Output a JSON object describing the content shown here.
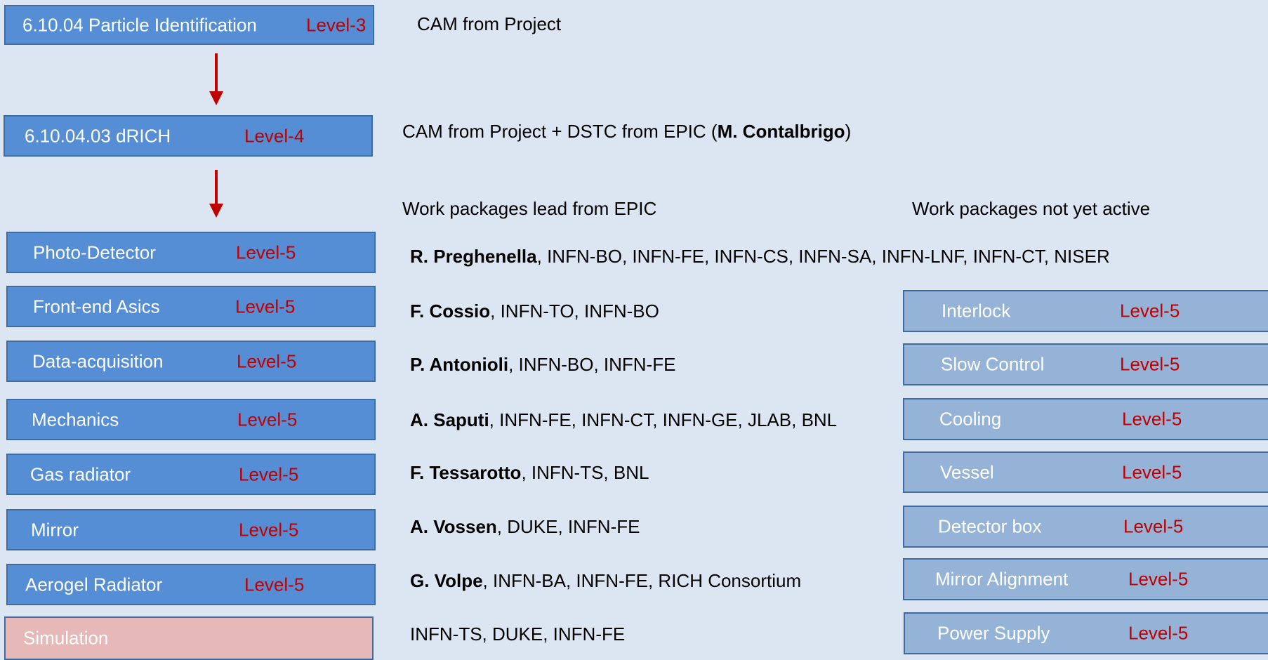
{
  "level3": {
    "label": "6.10.04 Particle Identification",
    "level": "Level-3"
  },
  "level4": {
    "label": "6.10.04.03  dRICH",
    "level": "Level-4"
  },
  "cam_project": "CAM from Project",
  "cam_dstc": {
    "prefix": "CAM from Project + DSTC from EPIC (",
    "name": "M. Contalbrigo",
    "suffix": ")"
  },
  "headers": {
    "active": "Work packages lead from EPIC",
    "inactive": "Work packages not yet active"
  },
  "work_packages": [
    {
      "label": "Photo-Detector",
      "level": "Level-5",
      "lead": "R. Preghenella",
      "members": ", INFN-BO, INFN-FE, INFN-CS, INFN-SA, INFN-LNF, INFN-CT, NISER"
    },
    {
      "label": "Front-end Asics",
      "level": "Level-5",
      "lead": "F. Cossio",
      "members": ",  INFN-TO, INFN-BO"
    },
    {
      "label": "Data-acquisition",
      "level": "Level-5",
      "lead": "P. Antonioli",
      "members": ", INFN-BO, INFN-FE"
    },
    {
      "label": "Mechanics",
      "level": "Level-5",
      "lead": "A. Saputi",
      "members": ", INFN-FE, INFN-CT, INFN-GE, JLAB, BNL"
    },
    {
      "label": "Gas radiator",
      "level": "Level-5",
      "lead": "F. Tessarotto",
      "members": ", INFN-TS, BNL"
    },
    {
      "label": "Mirror",
      "level": "Level-5",
      "lead": "A. Vossen",
      "members": ", DUKE, INFN-FE"
    },
    {
      "label": "Aerogel Radiator",
      "level": "Level-5",
      "lead": "G. Volpe",
      "members": ", INFN-BA, INFN-FE, RICH Consortium"
    },
    {
      "label": "Simulation",
      "level": "",
      "lead": "",
      "members": "INFN-TS, DUKE, INFN-FE"
    }
  ],
  "inactive_packages": [
    {
      "label": "Interlock",
      "level": "Level-5"
    },
    {
      "label": "Slow Control",
      "level": "Level-5"
    },
    {
      "label": "Cooling",
      "level": "Level-5"
    },
    {
      "label": "Vessel",
      "level": "Level-5"
    },
    {
      "label": "Detector box",
      "level": "Level-5"
    },
    {
      "label": "Mirror Alignment",
      "level": "Level-5"
    },
    {
      "label": "Power Supply",
      "level": "Level-5"
    }
  ],
  "colors": {
    "box_active": "#558ed5",
    "box_inactive": "#95b3d7",
    "box_simulation": "#e6b9b8",
    "level_text": "#c00000",
    "arrow": "#c00000",
    "background": "#dce6f2"
  }
}
